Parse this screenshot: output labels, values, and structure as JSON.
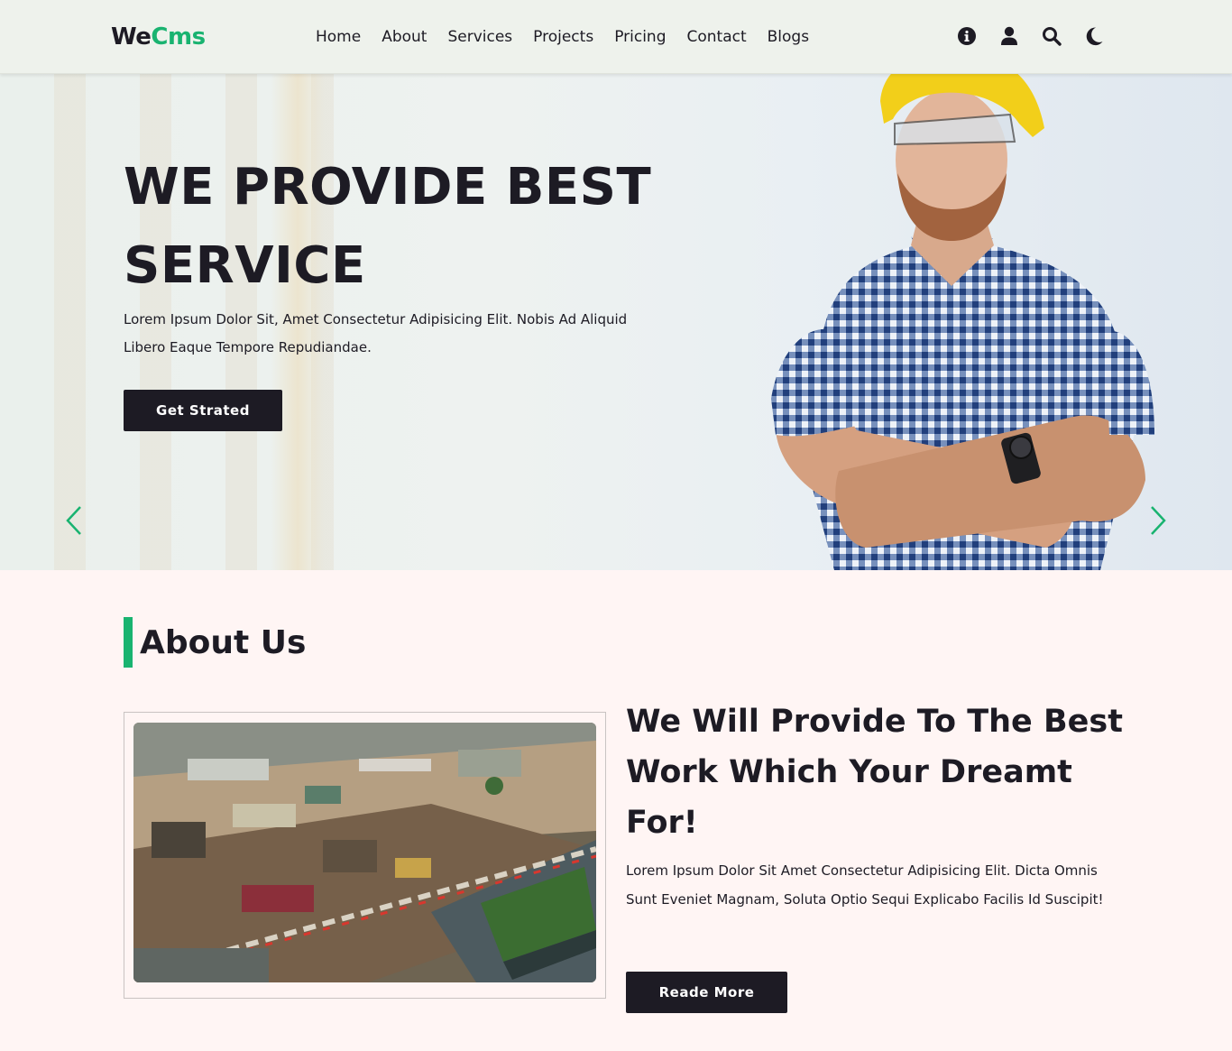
{
  "header": {
    "logo_part1": "We",
    "logo_part2": "Cms",
    "nav": [
      "Home",
      "About",
      "Services",
      "Projects",
      "Pricing",
      "Contact",
      "Blogs"
    ],
    "icons": [
      "info-icon",
      "user-icon",
      "search-icon",
      "moon-icon"
    ]
  },
  "hero": {
    "title_line1": "WE PROVIDE BEST",
    "title_line2": "SERVICE",
    "text": "Lorem Ipsum Dolor Sit, Amet Consectetur Adipisicing Elit. Nobis Ad Aliquid Libero Eaque Tempore Repudiandae.",
    "button": "Get Strated",
    "prev_icon": "chevron-left-icon",
    "next_icon": "chevron-right-icon"
  },
  "about": {
    "title": "About Us",
    "heading": "We Will Provide To The Best Work Which Your Dreamt For!",
    "text": "Lorem Ipsum Dolor Sit Amet Consectetur Adipisicing Elit. Dicta Omnis Sunt Eveniet Magnam, Soluta Optio Sequi Explicabo Facilis Id Suscipit!",
    "button": "Reade More"
  },
  "colors": {
    "accent": "#19b370",
    "dark": "#1d1b24",
    "header_bg": "#eef2ec",
    "section_bg": "#fff5f4"
  }
}
